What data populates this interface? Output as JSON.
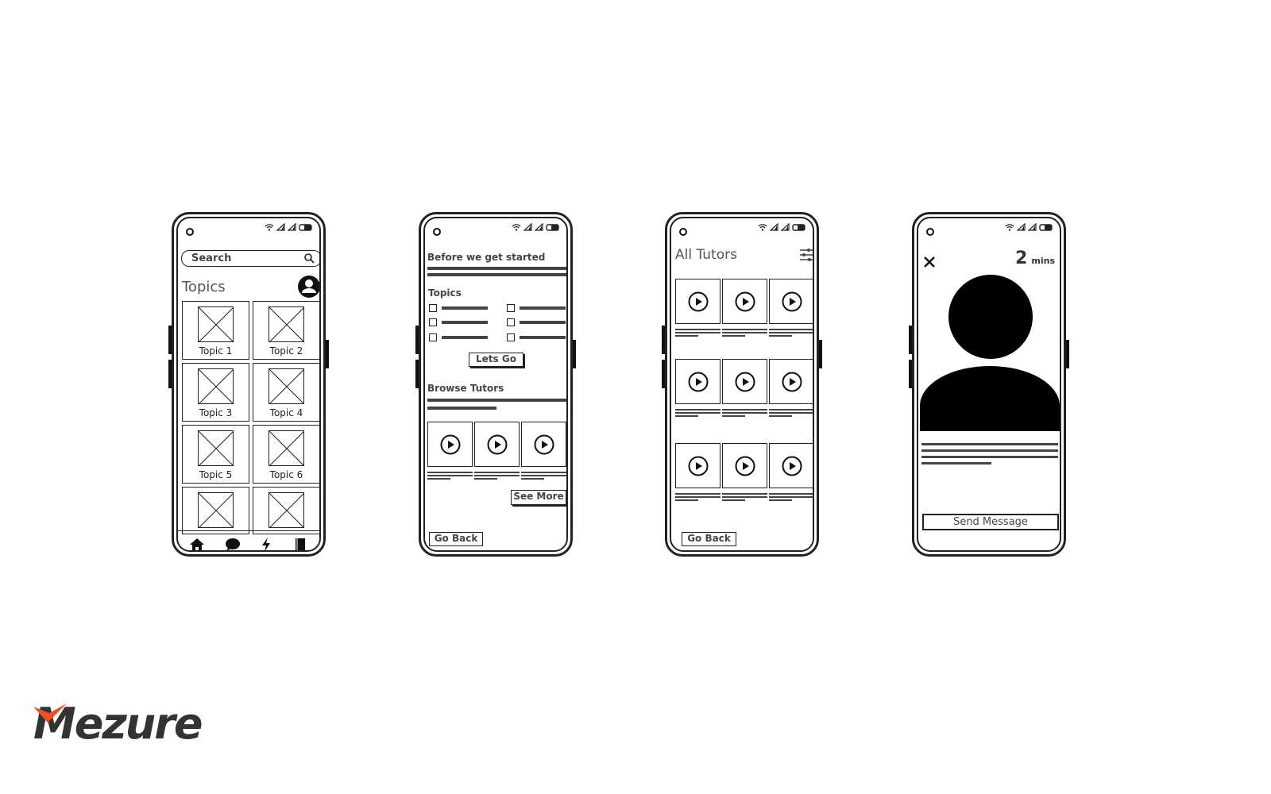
{
  "brand": {
    "logo": "Mezure",
    "accent": "#f04e23"
  },
  "screen1": {
    "search_placeholder": "Search",
    "title": "Topics",
    "topics": [
      "Topic 1",
      "Topic 2",
      "Topic 3",
      "Topic 4",
      "Topic 5",
      "Topic 6"
    ],
    "nav": [
      "home-icon",
      "chat-icon",
      "lightning-icon",
      "book-icon"
    ]
  },
  "screen2": {
    "title": "Before we get started",
    "topics_label": "Topics",
    "lets_go": "Lets Go",
    "browse_label": "Browse Tutors",
    "see_more": "See More",
    "go_back": "Go Back"
  },
  "screen3": {
    "title": "All Tutors",
    "go_back": "Go Back"
  },
  "screen4": {
    "timer_value": "2",
    "timer_unit": "mins",
    "send_message": "Send Message"
  }
}
